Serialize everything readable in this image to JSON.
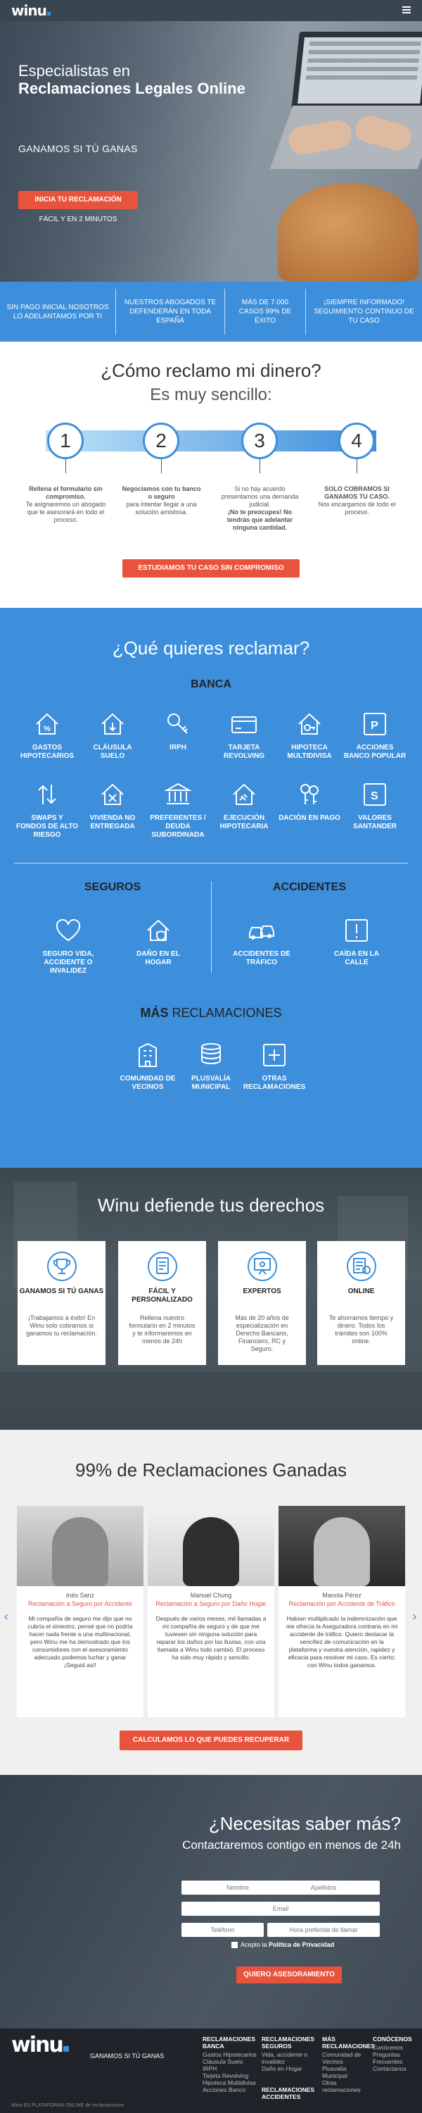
{
  "header": {
    "logo": "winu",
    "menu_icon": "hamburger-icon"
  },
  "hero": {
    "title_line1": "Especialistas en",
    "title_bold": "Reclamaciones Legales Online",
    "subtitle": "GANAMOS SI TÚ GANAS",
    "cta": "INICIA TU RECLAMACIÓN",
    "cta_note": "FÁCIL Y EN 2 MINUTOS"
  },
  "benefits": [
    "SIN PAGO INICIAL NOSOTROS LO ADELANTAMOS POR TI",
    "NUESTROS ABOGADOS TE DEFENDERÁN EN TODA ESPAÑA",
    "MÁS DE 7.000 CASOS 99% DE ÉXITO",
    "¡SIEMPRE INFORMADO! SEGUIMIENTO CONTINUO DE TU CASO"
  ],
  "steps": {
    "title": "¿Cómo reclamo mi dinero?",
    "subtitle": "Es muy sencillo:",
    "items": [
      {
        "num": "1",
        "bold": "Rellena el formulario sin compromiso.",
        "text": "Te asignaremos un abogado que te asesorará en todo el proceso."
      },
      {
        "num": "2",
        "bold": "Negociamos con tu banco o seguro",
        "text": "para intentar llegar a una solución amistosa."
      },
      {
        "num": "3",
        "pre": "Si no hay acuerdo presentamos una demanda judicial.",
        "bold": "¡No te preocupes! No tendrás que adelantar ninguna cantidad.",
        "text": ""
      },
      {
        "num": "4",
        "bold": "SOLO COBRAMOS SI GANAMOS TU CASO.",
        "text": "Nos encargamos de todo el proceso."
      }
    ],
    "cta": "ESTUDIAMOS TU CASO SIN COMPROMISO"
  },
  "claims": {
    "title": "¿Qué quieres reclamar?",
    "banca": {
      "title": "BANCA",
      "items": [
        {
          "label": "GASTOS HIPOTECARIOS",
          "icon": "house-percent-icon"
        },
        {
          "label": "CLÁUSULA SUELO",
          "icon": "house-down-arrow-icon"
        },
        {
          "label": "IRPH",
          "icon": "key-icon"
        },
        {
          "label": "TARJETA REVOLVING",
          "icon": "credit-card-icon"
        },
        {
          "label": "HIPOTECA MULTIDIVISA",
          "icon": "house-key-icon"
        },
        {
          "label": "ACCIONES BANCO POPULAR",
          "icon": "letter-p-icon"
        },
        {
          "label": "SWAPS Y FONDOS DE ALTO RIESGO",
          "icon": "swap-arrows-icon"
        },
        {
          "label": "VIVIENDA NO ENTREGADA",
          "icon": "house-cross-icon"
        },
        {
          "label": "PREFERENTES / DEUDA SUBORDINADA",
          "icon": "bank-icon"
        },
        {
          "label": "EJECUCIÓN HIPOTECARIA",
          "icon": "house-gavel-icon"
        },
        {
          "label": "DACIÓN EN PAGO",
          "icon": "keys-icon"
        },
        {
          "label": "VALORES SANTANDER",
          "icon": "letter-s-icon"
        }
      ]
    },
    "seguros": {
      "title": "SEGUROS",
      "items": [
        {
          "label": "SEGURO VIDA, ACCIDENTE O INVALIDEZ",
          "icon": "heart-icon"
        },
        {
          "label": "DAÑO EN EL HOGAR",
          "icon": "house-shield-icon"
        }
      ]
    },
    "accidentes": {
      "title": "ACCIDENTES",
      "items": [
        {
          "label": "ACCIDENTES DE TRÁFICO",
          "icon": "cars-crash-icon"
        },
        {
          "label": "CAÍDA EN LA CALLE",
          "icon": "warning-sign-icon"
        }
      ]
    },
    "mas": {
      "bold": "MÁS",
      "rest": "RECLAMACIONES",
      "items": [
        {
          "label": "COMUNIDAD DE VECINOS",
          "icon": "building-icon"
        },
        {
          "label": "PLUSVALÍA MUNICIPAL",
          "icon": "coins-icon"
        },
        {
          "label": "OTRAS RECLAMACIONES",
          "icon": "plus-box-icon"
        }
      ]
    }
  },
  "defend": {
    "title": "Winu defiende tus derechos",
    "cards": [
      {
        "title": "GANAMOS SI TÚ GANAS",
        "desc": "¡Trabajamos a éxito! En Winu solo cobramos si ganamos tu reclamación."
      },
      {
        "title": "FÁCIL Y PERSONALIZADO",
        "desc": "Rellena nuestro formulario en 2 minutos y te informaremos en menos de 24h"
      },
      {
        "title": "EXPERTOS",
        "desc": "Más de 20 años de especialización en Derecho Bancario, Financiero, RC y Seguro."
      },
      {
        "title": "ONLINE",
        "desc": "Te ahorramos tiempo y dinero. Todos los trámites son 100% online."
      }
    ]
  },
  "testimonials": {
    "title": "99% de Reclamaciones Ganadas",
    "cards": [
      {
        "name": "Inés Sanz",
        "role": "Reclamación a Seguro por Accidente",
        "quote": "Mi compañía de seguro me dijo que no cubría el siniestro, pensé que no podría hacer nada frente a una multinacional, pero Winu me ha demostrado que los consumidores con el asesoramiento adecuado podemos luchar y ganar ¡Seguid así!"
      },
      {
        "name": "Manuel Chung",
        "role": "Reclamación a Seguro por Daño Hogar",
        "quote": "Después de varios meses, mil llamadas a mi compañía de seguro y de que me tuviesen sin ninguna solución para reparar los daños por las lluvias, con una llamada a Winu todo cambió. El proceso ha sido muy rápido y sencillo."
      },
      {
        "name": "Manola Pérez",
        "role": "Reclamación por Accidente de Tráfico",
        "quote": "Habían multiplicado la indemnización que me ofrecía la Aseguradora contraria en mi accidente de tráfico. Quiero destacar la sencillez de comunicación en la plataforma y vuestra atención, rapidez y eficacia para resolver mi caso. Es cierto: con Winu todos ganamos."
      }
    ],
    "cta": "CALCULAMOS LO QUE PUEDES RECUPERAR"
  },
  "contact": {
    "title": "¿Necesitas saber más?",
    "subtitle": "Contactaremos contigo en menos de 24h",
    "fields": {
      "nombre": "Nombre",
      "apellidos": "Apellidos",
      "email": "Email",
      "telefono": "Teléfono",
      "hora": "Hora preferida de llamar"
    },
    "privacy_pre": "Acepto la",
    "privacy_link": "Política de Privacidad",
    "cta": "QUIERO ASESORAMIENTO"
  },
  "footer": {
    "logo": "winu",
    "tagline": "GANAMOS SI TÚ GANAS",
    "cols": [
      {
        "title": "RECLAMACIONES",
        "sub": "BANCA",
        "links": [
          "Gastos Hipotecarios",
          "Cláusula Suelo",
          "IRPH",
          "Tarjeta Revolving",
          "Hipoteca Multidivisa",
          "Acciones Banco"
        ]
      },
      {
        "title": "RECLAMACIONES",
        "sub": "SEGUROS",
        "links": [
          "Vida, accidente o invalidez",
          "Daño en Hogar"
        ],
        "title2": "RECLAMACIONES",
        "sub2": "ACCIDENTES"
      },
      {
        "title": "MÁS",
        "sub": "RECLAMACIONES",
        "links": [
          "Comunidad de Vecinos",
          "Plusvalía Municipal",
          "Otras reclamaciones"
        ]
      },
      {
        "title": "CONÓCENOS",
        "sub": "",
        "links": [
          "Conócenos",
          "Preguntas Frecuentes",
          "Contáctanos"
        ]
      }
    ],
    "copyright": "Winu ES PLATAFORMA ONLINE de reclamaciones"
  },
  "colors": {
    "brand_blue": "#3d8edb",
    "accent_red": "#e8533d",
    "dark": "#20242a"
  }
}
